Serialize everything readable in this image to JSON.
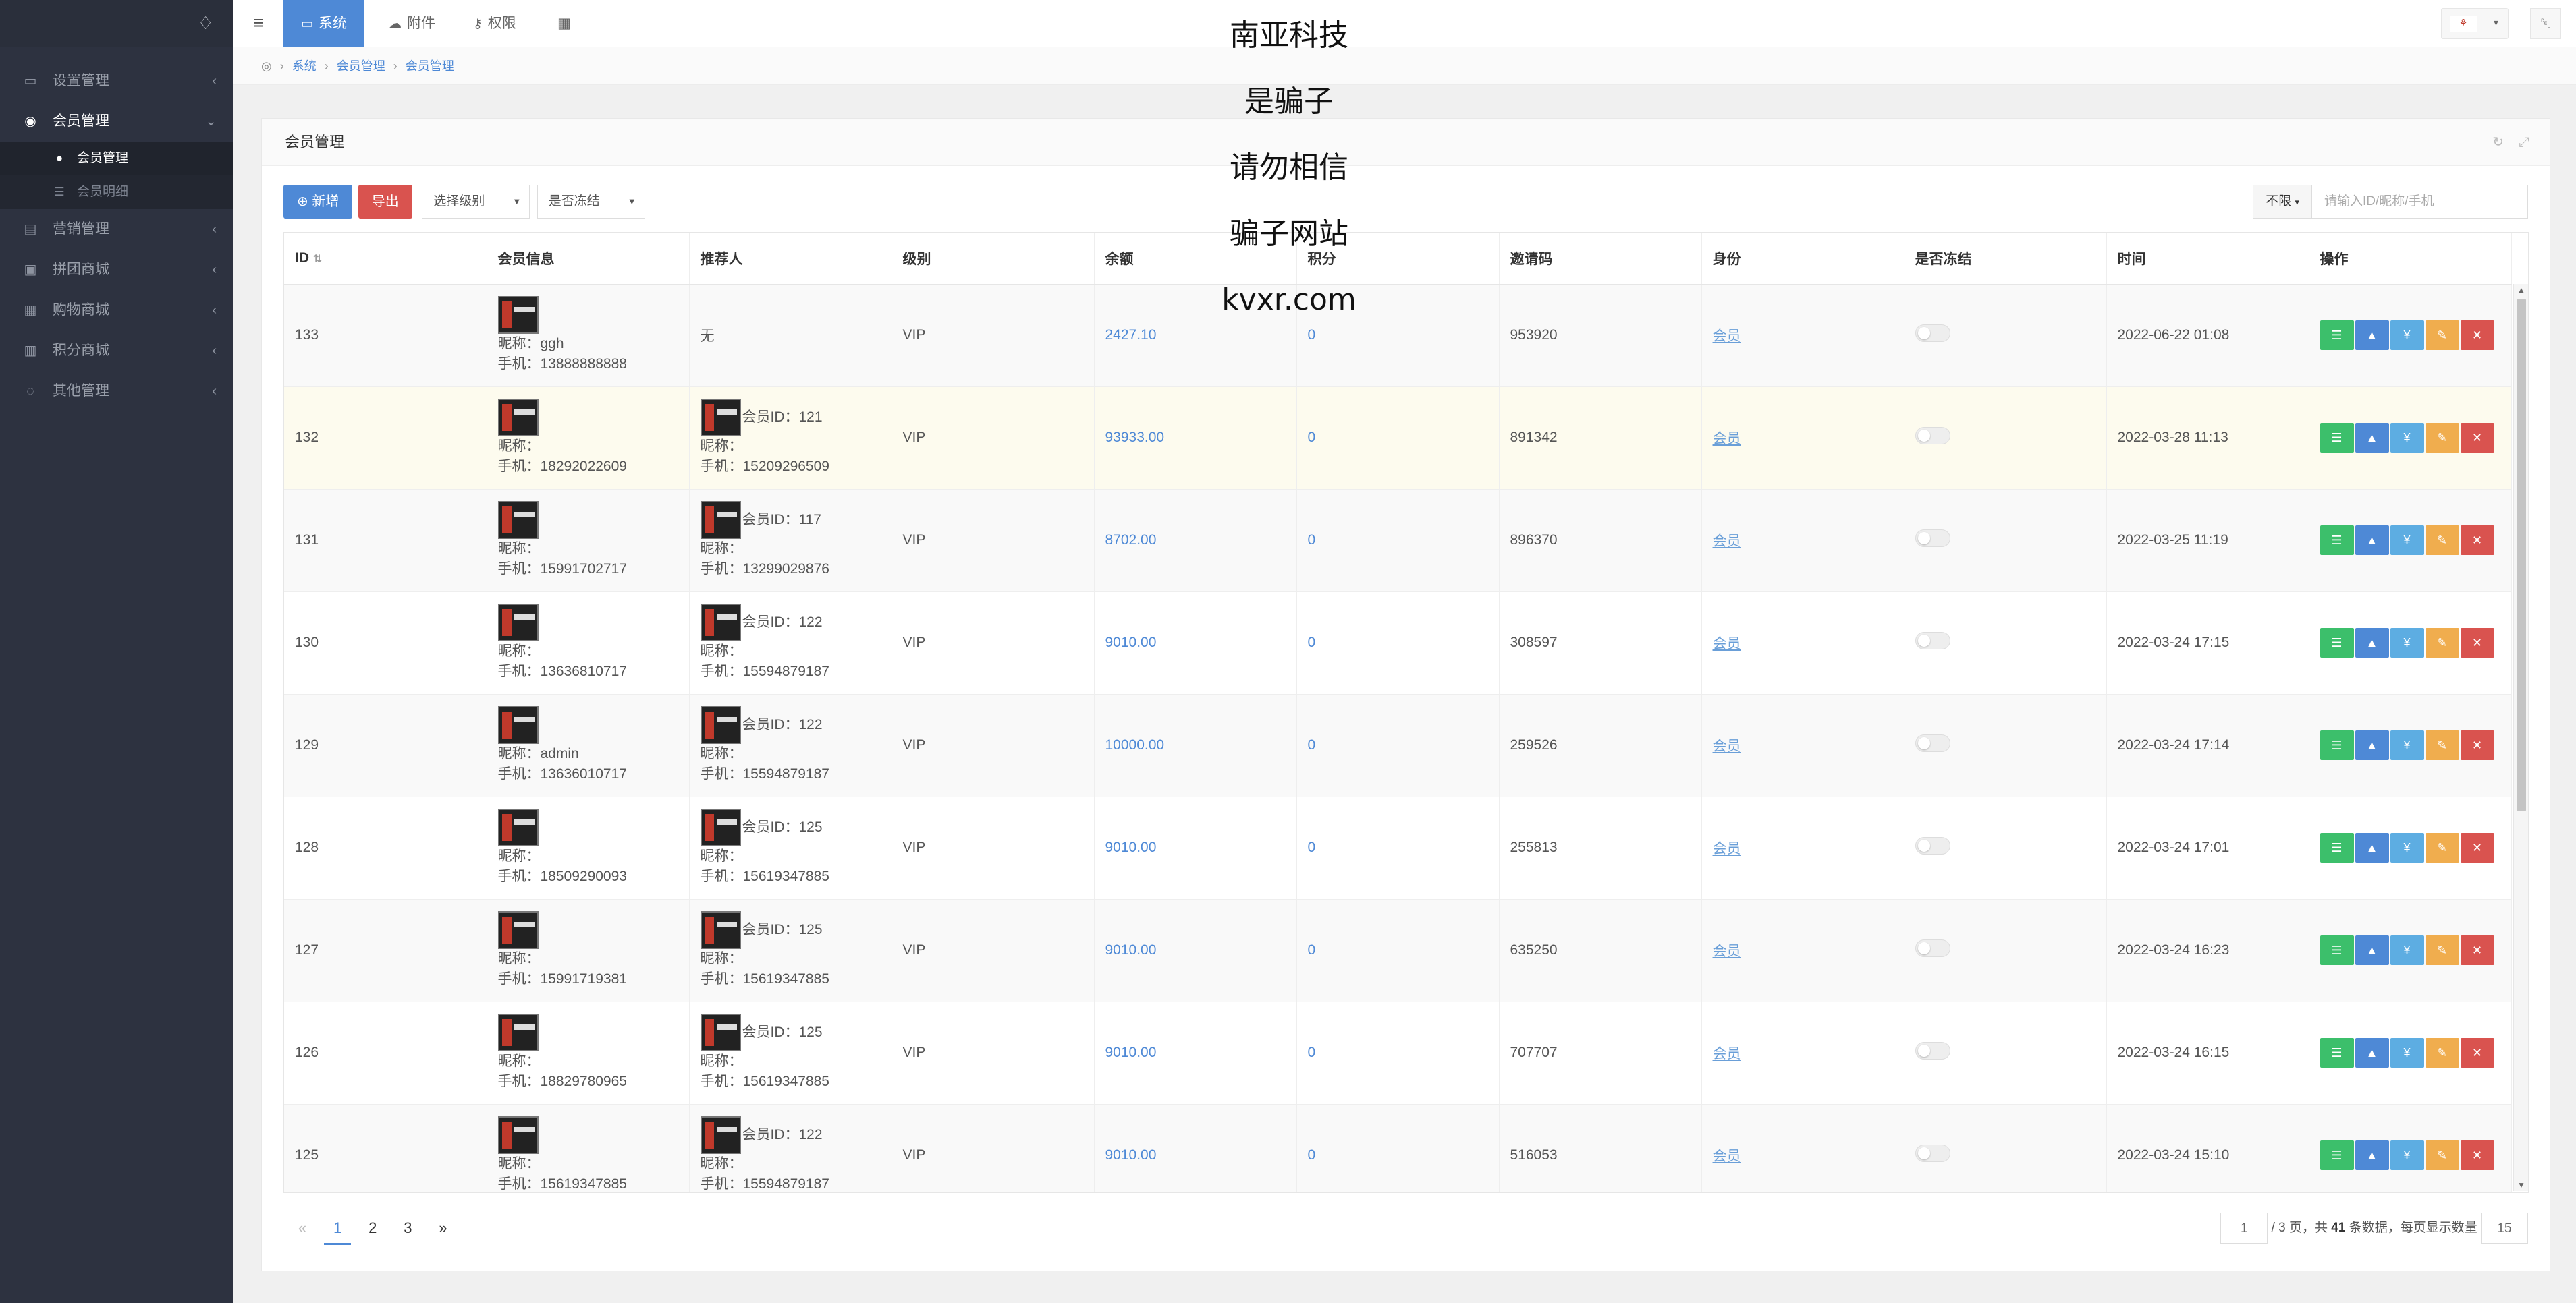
{
  "sidebar": {
    "items": [
      {
        "label": "设置管理",
        "icon": "folder-icon",
        "active": false
      },
      {
        "label": "会员管理",
        "icon": "user-circle-icon",
        "active": true
      },
      {
        "label": "营销管理",
        "icon": "card-icon",
        "active": false
      },
      {
        "label": "拼团商城",
        "icon": "basket-icon",
        "active": false
      },
      {
        "label": "购物商城",
        "icon": "cart-icon",
        "active": false
      },
      {
        "label": "积分商城",
        "icon": "bag-icon",
        "active": false
      },
      {
        "label": "其他管理",
        "icon": "chat-icon",
        "active": false
      }
    ],
    "subitems": [
      {
        "label": "会员管理",
        "icon": "user-icon",
        "active": true
      },
      {
        "label": "会员明细",
        "icon": "list-icon",
        "active": false
      }
    ]
  },
  "topbar": {
    "tabs": [
      {
        "label": "系统",
        "icon": "desktop-icon",
        "active": true
      },
      {
        "label": "附件",
        "icon": "cloud-icon",
        "active": false
      },
      {
        "label": "权限",
        "icon": "key-icon",
        "active": false
      }
    ]
  },
  "breadcrumb": [
    "系统",
    "会员管理",
    "会员管理"
  ],
  "panel": {
    "title": "会员管理"
  },
  "toolbar": {
    "add_label": "新增",
    "export_label": "导出",
    "level_select": "选择级别",
    "frozen_select": "是否冻结",
    "search_scope": "不限",
    "search_placeholder": "请输入ID/昵称/手机"
  },
  "table": {
    "headers": [
      "ID",
      "会员信息",
      "推荐人",
      "级别",
      "余额",
      "积分",
      "邀请码",
      "身份",
      "是否冻结",
      "时间",
      "操作"
    ],
    "rows": [
      {
        "id": "133",
        "nickname": "昵称：ggh",
        "phone": "手机：13888888888",
        "ref_id": "",
        "ref_nick": "",
        "ref_phone": "",
        "ref_none": "无",
        "level": "VIP",
        "balance": "2427.10",
        "points": "0",
        "invite": "953920",
        "role": "会员",
        "time": "2022-06-22 01:08"
      },
      {
        "id": "132",
        "nickname": "昵称：",
        "phone": "手机：18292022609",
        "ref_id": "会员ID：121",
        "ref_nick": "昵称：",
        "ref_phone": "手机：15209296509",
        "ref_none": "",
        "level": "VIP",
        "balance": "93933.00",
        "points": "0",
        "invite": "891342",
        "role": "会员",
        "time": "2022-03-28 11:13"
      },
      {
        "id": "131",
        "nickname": "昵称：",
        "phone": "手机：15991702717",
        "ref_id": "会员ID：117",
        "ref_nick": "昵称：",
        "ref_phone": "手机：13299029876",
        "ref_none": "",
        "level": "VIP",
        "balance": "8702.00",
        "points": "0",
        "invite": "896370",
        "role": "会员",
        "time": "2022-03-25 11:19"
      },
      {
        "id": "130",
        "nickname": "昵称：",
        "phone": "手机：13636810717",
        "ref_id": "会员ID：122",
        "ref_nick": "昵称：",
        "ref_phone": "手机：15594879187",
        "ref_none": "",
        "level": "VIP",
        "balance": "9010.00",
        "points": "0",
        "invite": "308597",
        "role": "会员",
        "time": "2022-03-24 17:15"
      },
      {
        "id": "129",
        "nickname": "昵称：admin",
        "phone": "手机：13636010717",
        "ref_id": "会员ID：122",
        "ref_nick": "昵称：",
        "ref_phone": "手机：15594879187",
        "ref_none": "",
        "level": "VIP",
        "balance": "10000.00",
        "points": "0",
        "invite": "259526",
        "role": "会员",
        "time": "2022-03-24 17:14"
      },
      {
        "id": "128",
        "nickname": "昵称：",
        "phone": "手机：18509290093",
        "ref_id": "会员ID：125",
        "ref_nick": "昵称：",
        "ref_phone": "手机：15619347885",
        "ref_none": "",
        "level": "VIP",
        "balance": "9010.00",
        "points": "0",
        "invite": "255813",
        "role": "会员",
        "time": "2022-03-24 17:01"
      },
      {
        "id": "127",
        "nickname": "昵称：",
        "phone": "手机：15991719381",
        "ref_id": "会员ID：125",
        "ref_nick": "昵称：",
        "ref_phone": "手机：15619347885",
        "ref_none": "",
        "level": "VIP",
        "balance": "9010.00",
        "points": "0",
        "invite": "635250",
        "role": "会员",
        "time": "2022-03-24 16:23"
      },
      {
        "id": "126",
        "nickname": "昵称：",
        "phone": "手机：18829780965",
        "ref_id": "会员ID：125",
        "ref_nick": "昵称：",
        "ref_phone": "手机：15619347885",
        "ref_none": "",
        "level": "VIP",
        "balance": "9010.00",
        "points": "0",
        "invite": "707707",
        "role": "会员",
        "time": "2022-03-24 16:15"
      },
      {
        "id": "125",
        "nickname": "昵称：",
        "phone": "手机：15619347885",
        "ref_id": "会员ID：122",
        "ref_nick": "昵称：",
        "ref_phone": "手机：15594879187",
        "ref_none": "",
        "level": "VIP",
        "balance": "9010.00",
        "points": "0",
        "invite": "516053",
        "role": "会员",
        "time": "2022-03-24 15:10"
      }
    ],
    "op_icons": [
      "sitemap-icon",
      "shirt-icon",
      "yen-icon",
      "pencil-icon",
      "close-icon"
    ]
  },
  "pagination": {
    "prev": "«",
    "pages": [
      "1",
      "2",
      "3"
    ],
    "next": "»",
    "current_page_input": "1",
    "total_text_a": "/ 3 页，共",
    "total_count": "41",
    "total_text_b": "条数据，每页显示数量",
    "per_page": "15"
  },
  "watermark": [
    "南亚科技",
    "是骗子",
    "请勿相信",
    "骗子网站",
    "kvxr.com"
  ],
  "colors": {
    "primary": "#4e89d6",
    "danger": "#d9534f",
    "success": "#3cbf6b",
    "warning": "#f0ad4e",
    "sidebar": "#2d3240"
  }
}
